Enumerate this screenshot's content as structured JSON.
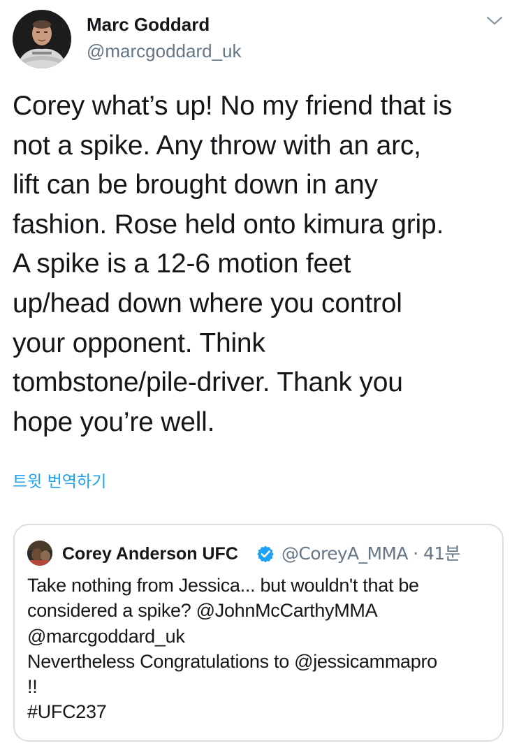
{
  "author": {
    "display_name": "Marc Goddard",
    "handle": "@marcgoddard_uk",
    "avatar_icon": "profile-photo"
  },
  "menu": {
    "icon": "chevron-down-icon"
  },
  "tweet": {
    "text": "Corey what’s up! No my friend that is\nnot a spike. Any throw with an arc,\nlift can be brought down in any\nfashion. Rose held onto kimura grip.\nA spike is a 12-6 motion feet\nup/head down where you control\nyour opponent. Think\ntombstone/pile-driver. Thank you\nhope you’re well."
  },
  "translate": {
    "label": "트윗 번역하기"
  },
  "quoted_tweet": {
    "display_name": "Corey Anderson UFC",
    "verified": true,
    "meta": "@CoreyA_MMA · 41분",
    "text": "Take nothing from Jessica... but wouldn't that be\nconsidered a spike? @JohnMcCarthyMMA\n@marcgoddard_uk\nNevertheless Congratulations to @jessicammapro\n!!\n#UFC237"
  },
  "colors": {
    "link": "#1da1f2",
    "secondary_text": "#657786",
    "border": "#d9dee3",
    "verified": "#1da1f2"
  }
}
